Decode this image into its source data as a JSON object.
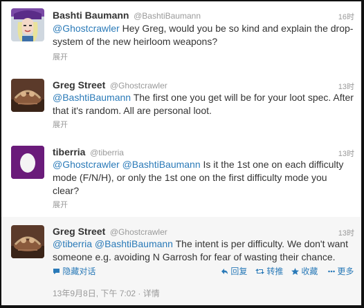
{
  "tweets": [
    {
      "name": "Bashti Baumann",
      "handle": "@BashtiBaumann",
      "time": "16时",
      "mention1": "@Ghostcrawler",
      "text": " Hey Greg, would you be so kind and explain the drop-system of the new heirloom weapons?",
      "expand": "展开"
    },
    {
      "name": "Greg Street",
      "handle": "@Ghostcrawler",
      "time": "13时",
      "mention1": "@BashtiBaumann",
      "text": " The first one you get will be for your loot spec. After that it's random. All are personal loot.",
      "expand": "展开"
    },
    {
      "name": "tiberria",
      "handle": "@tiberria",
      "time": "13时",
      "mention1": "@Ghostcrawler",
      "mention2": "@BashtiBaumann",
      "text": " Is it the 1st one on each difficulty mode (F/N/H), or only the 1st one on the first difficulty mode you clear?",
      "expand": "展开"
    },
    {
      "name": "Greg Street",
      "handle": "@Ghostcrawler",
      "time": "13时",
      "mention1": "@tiberria",
      "mention2": "@BashtiBaumann",
      "text": " The intent is per difficulty. We don't want someone e.g. avoiding N Garrosh for fear of wasting their chance.",
      "hide_conversation": "隐藏对话",
      "reply": "回复",
      "retweet": "转推",
      "favorite": "收藏",
      "more": "更多",
      "timestamp": "13年9月8日, 下午 7:02 · 详情"
    }
  ],
  "icons": {
    "hide": "chat-bubble-icon",
    "reply": "reply-arrow-icon",
    "retweet": "retweet-icon",
    "favorite": "star-icon",
    "more": "more-dots-icon"
  },
  "colors": {
    "link": "#2a7ab8",
    "meta": "#999999",
    "name": "#333333",
    "tiberria_avatar": "#6a1b7a"
  }
}
